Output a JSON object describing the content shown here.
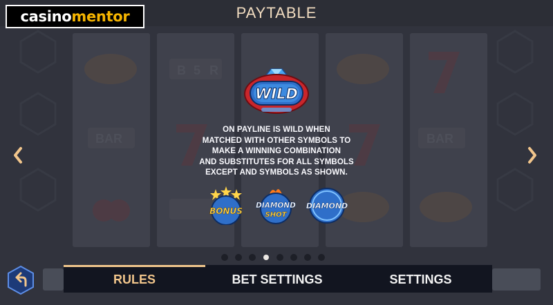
{
  "logo": {
    "part1": "casino",
    "part2": "mentor"
  },
  "header": {
    "title": "PAYTABLE"
  },
  "symbol": {
    "wild_label": "WILD"
  },
  "description": [
    "ON PAYLINE IS WILD WHEN",
    "MATCHED WITH OTHER SYMBOLS TO",
    "MAKE A WINNING COMBINATION",
    "AND SUBSTITUTES FOR ALL SYMBOLS",
    "EXCEPT AND SYMBOLS AS SHOWN."
  ],
  "excluded_symbols": {
    "bonus": "BONUS",
    "diamond_shot_1": "DIAMOND",
    "diamond_shot_2": "SHOT",
    "diamond": "DIAMOND"
  },
  "pagination": {
    "total": 8,
    "active_index": 3
  },
  "tabs": {
    "rules": "RULES",
    "bet_settings": "BET SETTINGS",
    "settings": "SETTINGS"
  },
  "background_reel_text": {
    "bar": "BAR",
    "bar_5": "5",
    "bar_left": "B",
    "bar_right": "R"
  },
  "colors": {
    "accent": "#f2c68c",
    "bar": "#121520",
    "title": "#f1dcc0"
  }
}
